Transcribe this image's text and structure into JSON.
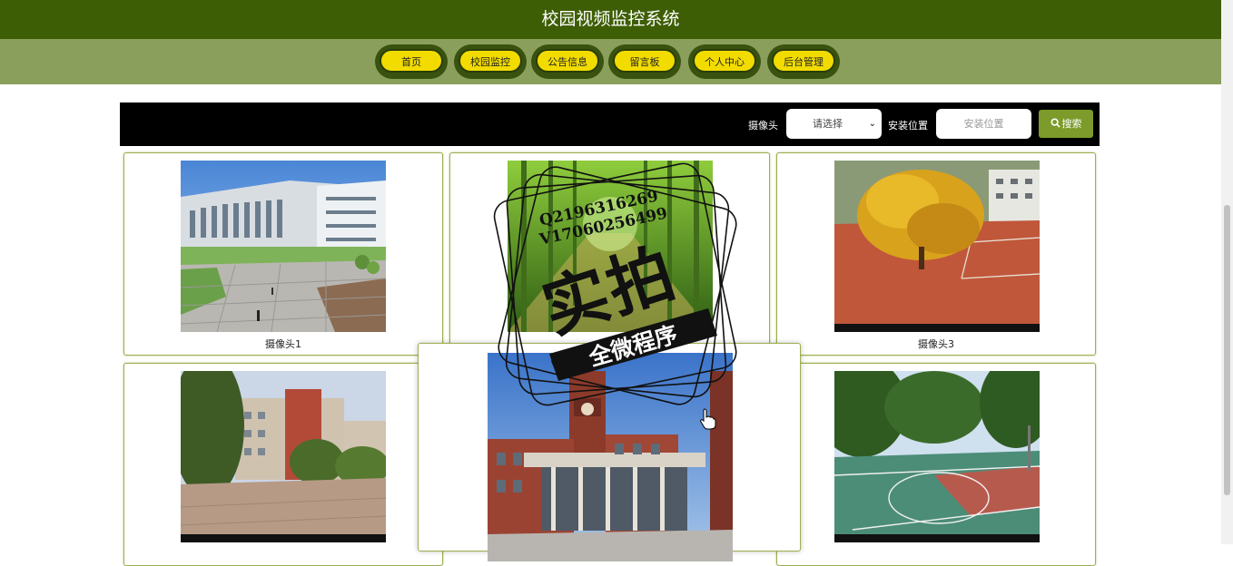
{
  "header": {
    "title": "校园视频监控系统"
  },
  "nav": {
    "items": [
      {
        "label": "首页"
      },
      {
        "label": "校园监控"
      },
      {
        "label": "公告信息"
      },
      {
        "label": "留言板"
      },
      {
        "label": "个人中心"
      },
      {
        "label": "后台管理"
      }
    ]
  },
  "search": {
    "camera_label": "摄像头",
    "camera_select_value": "请选择",
    "location_label": "安装位置",
    "location_placeholder": "安装位置",
    "button_label": "搜索"
  },
  "cards": [
    {
      "label": "摄像头1"
    },
    {
      "label": ""
    },
    {
      "label": "摄像头3"
    }
  ],
  "watermark": {
    "line1": "Q2196316269",
    "line2": "V17060256499",
    "big": "实拍",
    "ribbon": "全微程序"
  },
  "colors": {
    "header_bg": "#3e5e05",
    "nav_bg": "#8a9f5c",
    "pill": "#f2dc00",
    "search_btn": "#7c9b2a"
  }
}
